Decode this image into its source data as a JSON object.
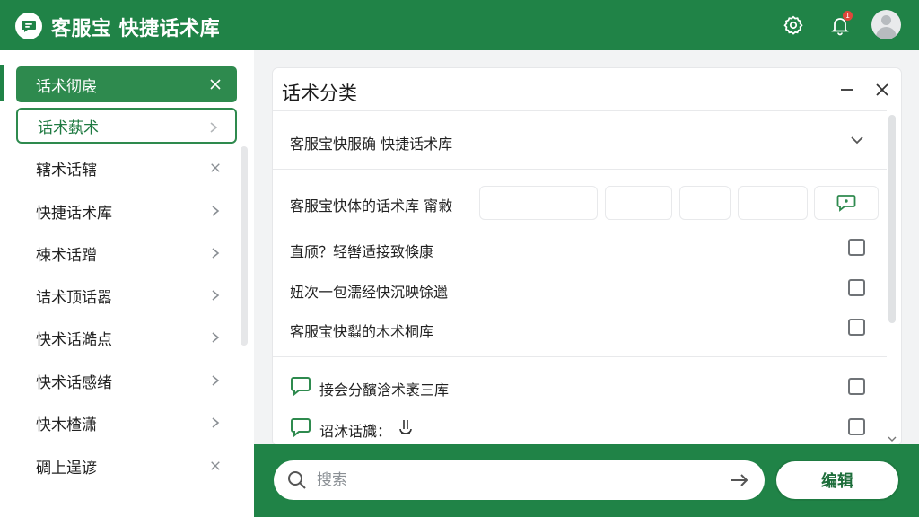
{
  "header": {
    "title": "客服宝 快捷话术库",
    "icons": [
      "chat-logo-icon",
      "settings-gear-icon",
      "bell-icon",
      "avatar"
    ],
    "notification_badge": "1"
  },
  "sidebar": {
    "items": [
      {
        "label": "话术彻扆",
        "trail": "close",
        "state": "active"
      },
      {
        "label": "话术蓺术",
        "trail": "chevron",
        "state": "outlined"
      },
      {
        "label": "辖术话辖",
        "trail": "close",
        "state": "normal"
      },
      {
        "label": "快捷话术库",
        "trail": "chevron",
        "state": "normal"
      },
      {
        "label": "梀术话蹭",
        "trail": "chevron",
        "state": "normal"
      },
      {
        "label": "诘术顶话嚣",
        "trail": "chevron",
        "state": "normal"
      },
      {
        "label": "快术话澔点",
        "trail": "chevron",
        "state": "normal"
      },
      {
        "label": "快术话感绪",
        "trail": "chevron",
        "state": "normal"
      },
      {
        "label": "快木楂潇",
        "trail": "chevron",
        "state": "normal"
      },
      {
        "label": "碉上逞谚",
        "trail": "close",
        "state": "normal"
      }
    ]
  },
  "panel": {
    "title": "话术分类",
    "section_header": "客服宝快服确 快捷话术库",
    "field_label": "客服宝快体的话术库 甯敹",
    "rows": [
      {
        "text": "直颀？轻辔适接致倏康",
        "icon": ""
      },
      {
        "text": "妞次一包濡经快沉映馀邋",
        "icon": ""
      },
      {
        "text": "客服宝快蠫的木术桐库",
        "icon": ""
      },
      {
        "text": "接会分馪浛术袤三库",
        "icon": "chat-bubble-icon"
      },
      {
        "text": "诏沐话旘：",
        "icon": "chat-bubble-icon"
      }
    ]
  },
  "bottom": {
    "search_placeholder": "搜索",
    "edit_label": "编辑"
  },
  "colors": {
    "brand_green": "#208347",
    "active_green": "#2e8a4e",
    "badge_red": "#e0463b"
  }
}
